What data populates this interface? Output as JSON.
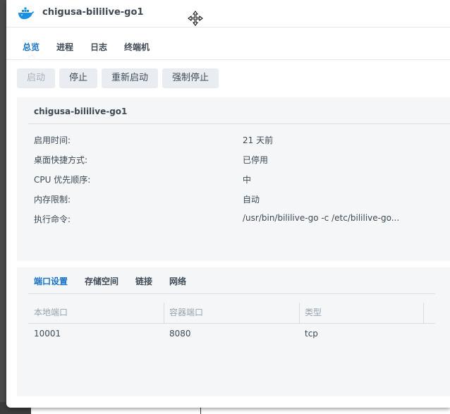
{
  "window": {
    "title": "chigusa-bililive-go1"
  },
  "tabs": [
    {
      "label": "总览",
      "active": true
    },
    {
      "label": "进程",
      "active": false
    },
    {
      "label": "日志",
      "active": false
    },
    {
      "label": "终端机",
      "active": false
    }
  ],
  "toolbar": {
    "start": "启动",
    "stop": "停止",
    "restart": "重新启动",
    "force_stop": "强制停止"
  },
  "details": {
    "title": "chigusa-bililive-go1",
    "rows": [
      {
        "label": "启用时间:",
        "value": "21 天前"
      },
      {
        "label": "桌面快捷方式:",
        "value": "已停用"
      },
      {
        "label": "CPU 优先顺序:",
        "value": "中"
      },
      {
        "label": "内存限制:",
        "value": "自动"
      },
      {
        "label": "执行命令:",
        "value": "/usr/bin/bililive-go -c /etc/bililive-go..."
      }
    ]
  },
  "subtabs": [
    {
      "label": "端口设置",
      "active": true
    },
    {
      "label": "存储空间",
      "active": false
    },
    {
      "label": "链接",
      "active": false
    },
    {
      "label": "网络",
      "active": false
    }
  ],
  "ports_table": {
    "headers": [
      "本地端口",
      "容器端口",
      "类型"
    ],
    "rows": [
      [
        "10001",
        "8080",
        "tcp"
      ]
    ]
  },
  "colors": {
    "accent": "#1a73c8",
    "text": "#3f4a55",
    "panel": "#f4f6f8",
    "docker_blue": "#1d91e0"
  },
  "icons": {
    "app": "docker-whale-icon",
    "cursor": "move-cursor-icon"
  }
}
